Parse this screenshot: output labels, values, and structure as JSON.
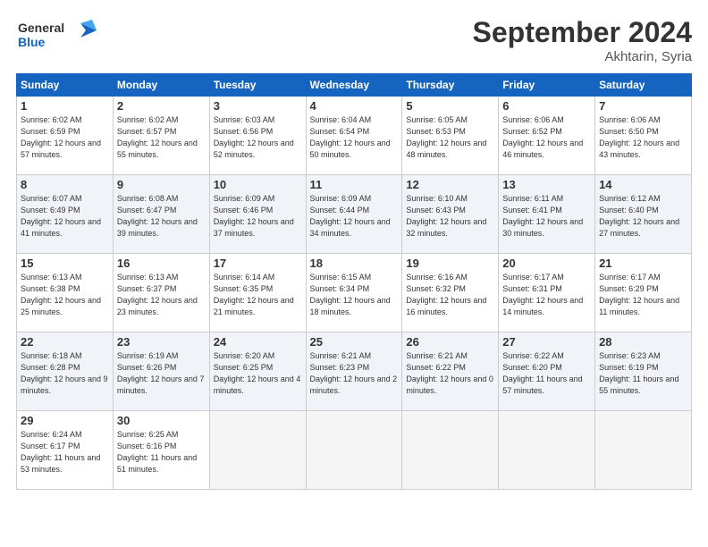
{
  "header": {
    "logo_line1": "General",
    "logo_line2": "Blue",
    "title": "September 2024",
    "location": "Akhtarin, Syria"
  },
  "weekdays": [
    "Sunday",
    "Monday",
    "Tuesday",
    "Wednesday",
    "Thursday",
    "Friday",
    "Saturday"
  ],
  "weeks": [
    [
      {
        "day": "1",
        "sunrise": "6:02 AM",
        "sunset": "6:59 PM",
        "daylight": "12 hours and 57 minutes."
      },
      {
        "day": "2",
        "sunrise": "6:02 AM",
        "sunset": "6:57 PM",
        "daylight": "12 hours and 55 minutes."
      },
      {
        "day": "3",
        "sunrise": "6:03 AM",
        "sunset": "6:56 PM",
        "daylight": "12 hours and 52 minutes."
      },
      {
        "day": "4",
        "sunrise": "6:04 AM",
        "sunset": "6:54 PM",
        "daylight": "12 hours and 50 minutes."
      },
      {
        "day": "5",
        "sunrise": "6:05 AM",
        "sunset": "6:53 PM",
        "daylight": "12 hours and 48 minutes."
      },
      {
        "day": "6",
        "sunrise": "6:06 AM",
        "sunset": "6:52 PM",
        "daylight": "12 hours and 46 minutes."
      },
      {
        "day": "7",
        "sunrise": "6:06 AM",
        "sunset": "6:50 PM",
        "daylight": "12 hours and 43 minutes."
      }
    ],
    [
      {
        "day": "8",
        "sunrise": "6:07 AM",
        "sunset": "6:49 PM",
        "daylight": "12 hours and 41 minutes."
      },
      {
        "day": "9",
        "sunrise": "6:08 AM",
        "sunset": "6:47 PM",
        "daylight": "12 hours and 39 minutes."
      },
      {
        "day": "10",
        "sunrise": "6:09 AM",
        "sunset": "6:46 PM",
        "daylight": "12 hours and 37 minutes."
      },
      {
        "day": "11",
        "sunrise": "6:09 AM",
        "sunset": "6:44 PM",
        "daylight": "12 hours and 34 minutes."
      },
      {
        "day": "12",
        "sunrise": "6:10 AM",
        "sunset": "6:43 PM",
        "daylight": "12 hours and 32 minutes."
      },
      {
        "day": "13",
        "sunrise": "6:11 AM",
        "sunset": "6:41 PM",
        "daylight": "12 hours and 30 minutes."
      },
      {
        "day": "14",
        "sunrise": "6:12 AM",
        "sunset": "6:40 PM",
        "daylight": "12 hours and 27 minutes."
      }
    ],
    [
      {
        "day": "15",
        "sunrise": "6:13 AM",
        "sunset": "6:38 PM",
        "daylight": "12 hours and 25 minutes."
      },
      {
        "day": "16",
        "sunrise": "6:13 AM",
        "sunset": "6:37 PM",
        "daylight": "12 hours and 23 minutes."
      },
      {
        "day": "17",
        "sunrise": "6:14 AM",
        "sunset": "6:35 PM",
        "daylight": "12 hours and 21 minutes."
      },
      {
        "day": "18",
        "sunrise": "6:15 AM",
        "sunset": "6:34 PM",
        "daylight": "12 hours and 18 minutes."
      },
      {
        "day": "19",
        "sunrise": "6:16 AM",
        "sunset": "6:32 PM",
        "daylight": "12 hours and 16 minutes."
      },
      {
        "day": "20",
        "sunrise": "6:17 AM",
        "sunset": "6:31 PM",
        "daylight": "12 hours and 14 minutes."
      },
      {
        "day": "21",
        "sunrise": "6:17 AM",
        "sunset": "6:29 PM",
        "daylight": "12 hours and 11 minutes."
      }
    ],
    [
      {
        "day": "22",
        "sunrise": "6:18 AM",
        "sunset": "6:28 PM",
        "daylight": "12 hours and 9 minutes."
      },
      {
        "day": "23",
        "sunrise": "6:19 AM",
        "sunset": "6:26 PM",
        "daylight": "12 hours and 7 minutes."
      },
      {
        "day": "24",
        "sunrise": "6:20 AM",
        "sunset": "6:25 PM",
        "daylight": "12 hours and 4 minutes."
      },
      {
        "day": "25",
        "sunrise": "6:21 AM",
        "sunset": "6:23 PM",
        "daylight": "12 hours and 2 minutes."
      },
      {
        "day": "26",
        "sunrise": "6:21 AM",
        "sunset": "6:22 PM",
        "daylight": "12 hours and 0 minutes."
      },
      {
        "day": "27",
        "sunrise": "6:22 AM",
        "sunset": "6:20 PM",
        "daylight": "11 hours and 57 minutes."
      },
      {
        "day": "28",
        "sunrise": "6:23 AM",
        "sunset": "6:19 PM",
        "daylight": "11 hours and 55 minutes."
      }
    ],
    [
      {
        "day": "29",
        "sunrise": "6:24 AM",
        "sunset": "6:17 PM",
        "daylight": "11 hours and 53 minutes."
      },
      {
        "day": "30",
        "sunrise": "6:25 AM",
        "sunset": "6:16 PM",
        "daylight": "11 hours and 51 minutes."
      },
      null,
      null,
      null,
      null,
      null
    ]
  ]
}
